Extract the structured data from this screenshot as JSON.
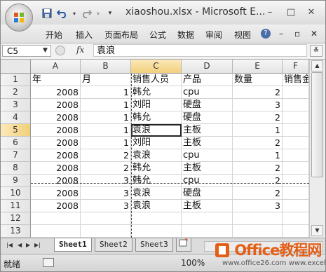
{
  "title": "xiaoshou.xlsx - Microsoft E...",
  "window_controls": [
    "–",
    "□",
    "✕"
  ],
  "quick_access": [
    "save-icon",
    "undo-icon",
    "redo-icon",
    "customize-qat-icon"
  ],
  "menu": [
    "开始",
    "插入",
    "页面布局",
    "公式",
    "数据",
    "审阅",
    "视图"
  ],
  "ribbon_controls": [
    "?",
    "–",
    "▫",
    "✕"
  ],
  "name_box": "C5",
  "fx_label": "fx",
  "formula_value": "袁浪",
  "columns": [
    "A",
    "B",
    "C",
    "D",
    "E",
    "F"
  ],
  "rows": [
    {
      "num": "1",
      "a": "年",
      "b": "月",
      "c": "销售人员",
      "d": "产品",
      "e": "数量",
      "f": "销售金"
    },
    {
      "num": "2",
      "a": "2008",
      "b": "1",
      "c": "韩允",
      "d": "cpu",
      "e": "2",
      "f": ""
    },
    {
      "num": "3",
      "a": "2008",
      "b": "1",
      "c": "刘阳",
      "d": "硬盘",
      "e": "3",
      "f": ""
    },
    {
      "num": "4",
      "a": "2008",
      "b": "1",
      "c": "韩允",
      "d": "硬盘",
      "e": "2",
      "f": ""
    },
    {
      "num": "5",
      "a": "2008",
      "b": "1",
      "c": "袁浪",
      "d": "主板",
      "e": "1",
      "f": ""
    },
    {
      "num": "6",
      "a": "2008",
      "b": "1",
      "c": "刘阳",
      "d": "主板",
      "e": "2",
      "f": ""
    },
    {
      "num": "7",
      "a": "2008",
      "b": "2",
      "c": "袁浪",
      "d": "cpu",
      "e": "1",
      "f": ""
    },
    {
      "num": "8",
      "a": "2008",
      "b": "2",
      "c": "韩允",
      "d": "主板",
      "e": "2",
      "f": ""
    },
    {
      "num": "9",
      "a": "2008",
      "b": "3",
      "c": "韩允",
      "d": "cpu",
      "e": "2",
      "f": ""
    },
    {
      "num": "10",
      "a": "2008",
      "b": "3",
      "c": "袁浪",
      "d": "硬盘",
      "e": "2",
      "f": ""
    },
    {
      "num": "11",
      "a": "2008",
      "b": "3",
      "c": "袁浪",
      "d": "主板",
      "e": "3",
      "f": ""
    },
    {
      "num": "12",
      "a": "",
      "b": "",
      "c": "",
      "d": "",
      "e": "",
      "f": ""
    },
    {
      "num": "13",
      "a": "",
      "b": "",
      "c": "",
      "d": "",
      "e": "",
      "f": ""
    }
  ],
  "sheet_nav": [
    "|◀",
    "◀",
    "▶",
    "▶|"
  ],
  "sheets": [
    "Sheet1",
    "Sheet2",
    "Sheet3"
  ],
  "status": {
    "ready": "就绪",
    "zoom": "100%"
  },
  "watermark": {
    "brand": "Office教程网",
    "url": "www.office26.com",
    "url2": "www.excelcw.com"
  },
  "colors": {
    "accent": "#e35f18",
    "selected_header": "#f2cf7a"
  }
}
